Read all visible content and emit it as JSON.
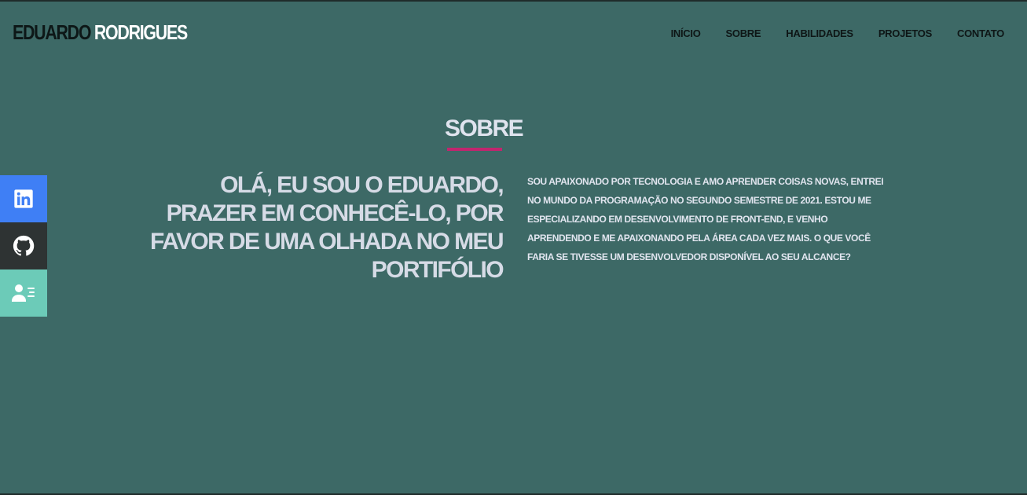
{
  "header": {
    "logo_first": "EDUARDO",
    "logo_last": "RODRIGUES",
    "nav": [
      {
        "label": "INÍCIO"
      },
      {
        "label": "SOBRE"
      },
      {
        "label": "HABILIDADES"
      },
      {
        "label": "PROJETOS"
      },
      {
        "label": "CONTATO"
      }
    ]
  },
  "about": {
    "section_title": "SOBRE",
    "heading": "OLÁ, EU SOU O EDUARDO, PRAZER EM CONHECÊ-LO, POR FAVOR DE UMA OLHADA NO MEU PORTIFÓLIO",
    "text": "SOU APAIXONADO POR TECNOLOGIA E AMO APRENDER COISAS NOVAS, ENTREI NO MUNDO DA PROGRAMAÇÃO NO SEGUNDO SEMESTRE DE 2021. ESTOU ME ESPECIALIZANDO EM DESENVOLVIMENTO DE FRONT-END, E VENHO APRENDENDO E ME APAIXONANDO PELA ÁREA CADA VEZ MAIS. O QUE VOCÊ FARIA SE TIVESSE UM DESENVOLVEDOR DISPONÍVEL AO SEU ALCANCE?"
  },
  "social": [
    {
      "icon": "linkedin-icon",
      "color": "#3f7ff5"
    },
    {
      "icon": "github-icon",
      "color": "#2e3333"
    },
    {
      "icon": "resume-icon",
      "color": "#6ccbb8"
    }
  ],
  "colors": {
    "background": "#3d6966",
    "accent": "#c2246e",
    "logo_dark": "#0d1717",
    "logo_light": "#ffffff"
  }
}
